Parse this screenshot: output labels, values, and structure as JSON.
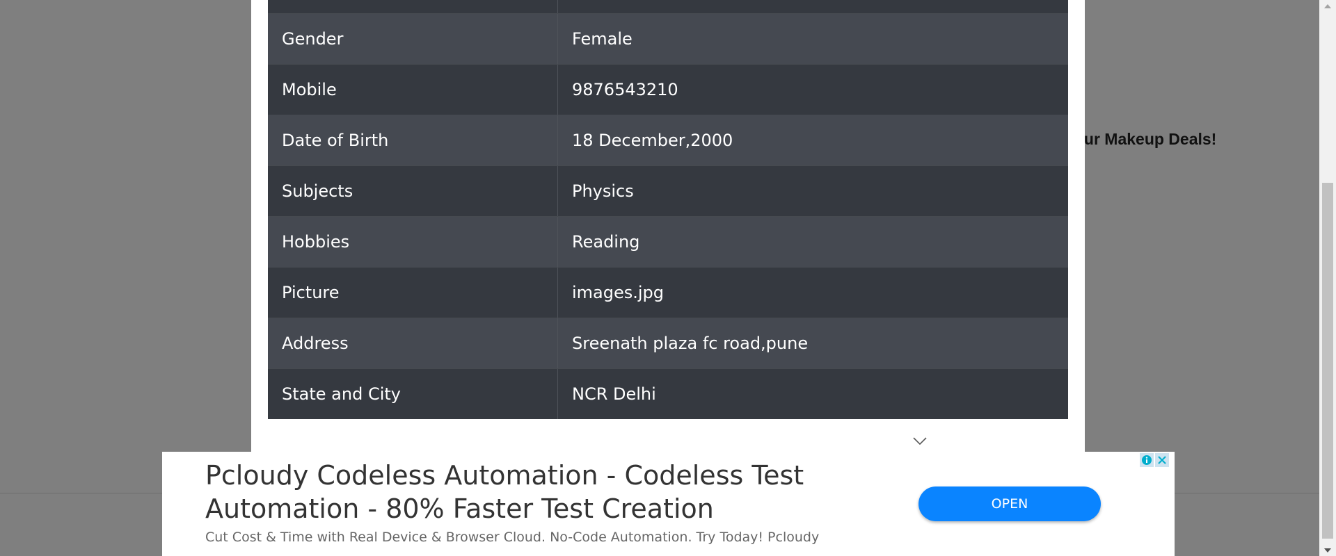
{
  "background": {
    "deal_text": "Our Makeup Deals!"
  },
  "table": {
    "rows": [
      {
        "label": "Gender",
        "value": "Female"
      },
      {
        "label": "Mobile",
        "value": "9876543210"
      },
      {
        "label": "Date of Birth",
        "value": "18 December,2000"
      },
      {
        "label": "Subjects",
        "value": "Physics"
      },
      {
        "label": "Hobbies",
        "value": "Reading"
      },
      {
        "label": "Picture",
        "value": "images.jpg"
      },
      {
        "label": "Address",
        "value": "Sreenath plaza fc road,pune"
      },
      {
        "label": "State and City",
        "value": "NCR Delhi"
      }
    ]
  },
  "ad": {
    "title": "Pcloudy Codeless Automation - Codeless Test Automation - 80% Faster Test Creation",
    "description": "Cut Cost & Time with Real Device & Browser Cloud. No-Code Automation. Try Today! Pcloudy",
    "open_label": "OPEN",
    "accent_color": "#0a84ff"
  },
  "icons": {
    "chevron": "chevron-down-icon",
    "info": "info-icon",
    "close": "close-icon"
  }
}
